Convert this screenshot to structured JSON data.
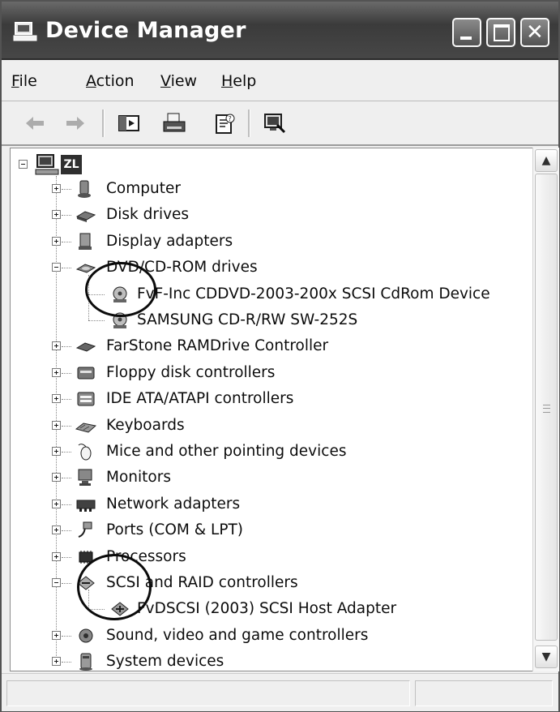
{
  "window": {
    "title": "Device Manager"
  },
  "menu": {
    "items": [
      {
        "label": "File",
        "accel": "F",
        "rest": "ile"
      },
      {
        "label": "Action",
        "accel": "A",
        "rest": "ction"
      },
      {
        "label": "View",
        "accel": "V",
        "rest": "iew"
      },
      {
        "label": "Help",
        "accel": "H",
        "rest": "elp"
      }
    ]
  },
  "toolbar": {
    "icons": [
      "back-arrow-icon",
      "forward-arrow-icon",
      "show-hide-console-tree-icon",
      "print-icon",
      "properties-icon",
      "scan-hardware-icon"
    ]
  },
  "tree": {
    "root": {
      "label": "ZL",
      "expanded": true
    },
    "items": [
      {
        "label": "Computer",
        "icon": "computer-icon",
        "expanded": false
      },
      {
        "label": "Disk drives",
        "icon": "disk-drive-icon",
        "expanded": false
      },
      {
        "label": "Display adapters",
        "icon": "display-adapter-icon",
        "expanded": false
      },
      {
        "label": "DVD/CD-ROM drives",
        "icon": "cdrom-drive-icon",
        "expanded": true
      },
      {
        "label": "FvF-Inc CDDVD-2003-200x SCSI CdRom Device",
        "icon": "cdrom-device-icon",
        "child": true
      },
      {
        "label": "SAMSUNG CD-R/RW SW-252S",
        "icon": "cdrom-device-icon",
        "child": true
      },
      {
        "label": "FarStone RAMDrive Controller",
        "icon": "ramdrive-icon",
        "expanded": false
      },
      {
        "label": "Floppy disk controllers",
        "icon": "floppy-controller-icon",
        "expanded": false
      },
      {
        "label": "IDE ATA/ATAPI controllers",
        "icon": "ide-controller-icon",
        "expanded": false
      },
      {
        "label": "Keyboards",
        "icon": "keyboard-icon",
        "expanded": false
      },
      {
        "label": "Mice and other pointing devices",
        "icon": "mouse-icon",
        "expanded": false
      },
      {
        "label": "Monitors",
        "icon": "monitor-icon",
        "expanded": false
      },
      {
        "label": "Network adapters",
        "icon": "network-adapter-icon",
        "expanded": false
      },
      {
        "label": "Ports (COM & LPT)",
        "icon": "port-icon",
        "expanded": false
      },
      {
        "label": "Processors",
        "icon": "processor-icon",
        "expanded": false
      },
      {
        "label": "SCSI and RAID controllers",
        "icon": "scsi-controller-icon",
        "expanded": true
      },
      {
        "label": "FvDSCSI (2003) SCSI Host Adapter",
        "icon": "scsi-adapter-icon",
        "child": true
      },
      {
        "label": "Sound, video and game controllers",
        "icon": "sound-icon",
        "expanded": false
      },
      {
        "label": "System devices",
        "icon": "system-device-icon",
        "expanded": false
      }
    ]
  },
  "scrollbar": {
    "up_glyph": "▲",
    "down_glyph": "▼"
  }
}
